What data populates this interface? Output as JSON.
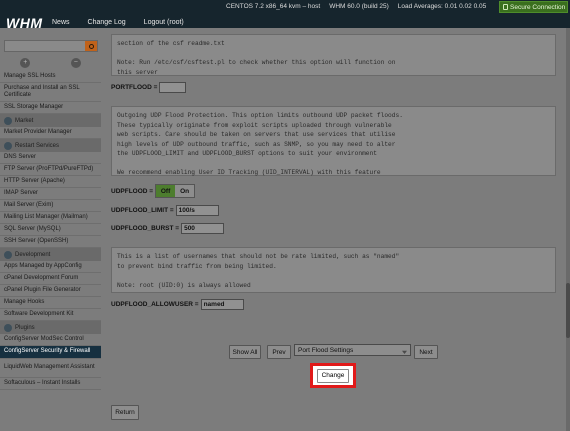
{
  "topbar": {
    "logo": "WHM",
    "nav": [
      "News",
      "Change Log",
      "Logout (root)"
    ],
    "os": "CENTOS 7.2 x86_64 kvm – host",
    "version": "WHM 60.0 (build 25)",
    "load": "Load Averages: 0.01 0.02 0.05",
    "secure": "Secure Connection"
  },
  "sidebar": {
    "items": [
      {
        "label": "Manage SSL Hosts",
        "type": "item"
      },
      {
        "label": "Purchase and Install an SSL Certificate",
        "type": "item"
      },
      {
        "label": "SSL Storage Manager",
        "type": "item"
      },
      {
        "label": "Market",
        "type": "header"
      },
      {
        "label": "Market Provider Manager",
        "type": "item"
      },
      {
        "label": "Restart Services",
        "type": "header"
      },
      {
        "label": "DNS Server",
        "type": "item"
      },
      {
        "label": "FTP Server (ProFTPd/PureFTPd)",
        "type": "item"
      },
      {
        "label": "HTTP Server (Apache)",
        "type": "item"
      },
      {
        "label": "IMAP Server",
        "type": "item"
      },
      {
        "label": "Mail Server (Exim)",
        "type": "item"
      },
      {
        "label": "Mailing List Manager (Mailman)",
        "type": "item"
      },
      {
        "label": "SQL Server (MySQL)",
        "type": "item"
      },
      {
        "label": "SSH Server (OpenSSH)",
        "type": "item"
      },
      {
        "label": "Development",
        "type": "header"
      },
      {
        "label": "Apps Managed by AppConfig",
        "type": "item"
      },
      {
        "label": "cPanel Development Forum",
        "type": "item"
      },
      {
        "label": "cPanel Plugin File Generator",
        "type": "item"
      },
      {
        "label": "Manage Hooks",
        "type": "item"
      },
      {
        "label": "Software Development Kit",
        "type": "item"
      },
      {
        "label": "Plugins",
        "type": "header"
      },
      {
        "label": "ConfigServer ModSec Control",
        "type": "item"
      },
      {
        "label": "ConfigServer Security & Firewall",
        "type": "active"
      },
      {
        "label": "LiquidWeb Management Assistant",
        "type": "item"
      },
      {
        "label": "Softaculous – Instant Installs",
        "type": "item"
      }
    ]
  },
  "main": {
    "box1_text": "section of the csf readme.txt\n\nNote: Run /etc/csf/csftest.pl to check whether this option will function on\nthis server",
    "portflood_label": "PORTFLOOD =",
    "portflood_value": "",
    "box2_text": "Outgoing UDP Flood Protection. This option limits outbound UDP packet floods.\nThese typically originate from exploit scripts uploaded through vulnerable\nweb scripts. Care should be taken on servers that use services that utilise\nhigh levels of UDP outbound traffic, such as SNMP, so you may need to alter\nthe UDPFLOOD_LIMIT and UDPFLOOD_BURST options to suit your environment\n\nWe recommend enabling User ID Tracking (UID_INTERVAL) with this feature",
    "udpflood_label": "UDPFLOOD =",
    "toggle_off": "Off",
    "toggle_on": "On",
    "limit_label": "UDPFLOOD_LIMIT =",
    "limit_value": "100/s",
    "burst_label": "UDPFLOOD_BURST =",
    "burst_value": "500",
    "box3_text": "This is a list of usernames that should not be rate limited, such as \"named\"\nto prevent bind traffic from being limited.\n\nNote: root (UID:0) is always allowed",
    "allowuser_label": "UDPFLOOD_ALLOWUSER =",
    "allowuser_value": "named",
    "show_all": "Show All",
    "prev": "Prev",
    "select_value": "Port Flood Settings",
    "next": "Next",
    "change": "Change",
    "return": "Return"
  }
}
